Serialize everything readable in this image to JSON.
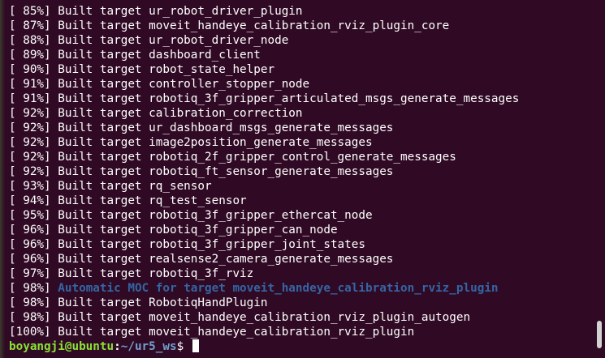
{
  "lines": [
    {
      "text": "[ 85%] Built target ur_robot_driver_plugin",
      "style": "normal"
    },
    {
      "text": "[ 87%] Built target moveit_handeye_calibration_rviz_plugin_core",
      "style": "normal"
    },
    {
      "text": "[ 88%] Built target ur_robot_driver_node",
      "style": "normal"
    },
    {
      "text": "[ 89%] Built target dashboard_client",
      "style": "normal"
    },
    {
      "text": "[ 90%] Built target robot_state_helper",
      "style": "normal"
    },
    {
      "text": "[ 91%] Built target controller_stopper_node",
      "style": "normal"
    },
    {
      "text": "[ 91%] Built target robotiq_3f_gripper_articulated_msgs_generate_messages",
      "style": "normal"
    },
    {
      "text": "[ 92%] Built target calibration_correction",
      "style": "normal"
    },
    {
      "text": "[ 92%] Built target ur_dashboard_msgs_generate_messages",
      "style": "normal"
    },
    {
      "text": "[ 92%] Built target image2position_generate_messages",
      "style": "normal"
    },
    {
      "text": "[ 92%] Built target robotiq_2f_gripper_control_generate_messages",
      "style": "normal"
    },
    {
      "text": "[ 92%] Built target robotiq_ft_sensor_generate_messages",
      "style": "normal"
    },
    {
      "text": "[ 93%] Built target rq_sensor",
      "style": "normal"
    },
    {
      "text": "[ 94%] Built target rq_test_sensor",
      "style": "normal"
    },
    {
      "text": "[ 95%] Built target robotiq_3f_gripper_ethercat_node",
      "style": "normal"
    },
    {
      "text": "[ 96%] Built target robotiq_3f_gripper_can_node",
      "style": "normal"
    },
    {
      "text": "[ 96%] Built target robotiq_3f_gripper_joint_states",
      "style": "normal"
    },
    {
      "text": "[ 96%] Built target realsense2_camera_generate_messages",
      "style": "normal"
    },
    {
      "text": "[ 97%] Built target robotiq_3f_rviz",
      "style": "normal"
    },
    {
      "text": "[ 98%] ",
      "style": "normal",
      "continuation": "Automatic MOC for target moveit_handeye_calibration_rviz_plugin"
    },
    {
      "text": "[ 98%] Built target RobotiqHandPlugin",
      "style": "normal"
    },
    {
      "text": "[ 98%] Built target moveit_handeye_calibration_rviz_plugin_autogen",
      "style": "normal"
    },
    {
      "text": "[100%] Built target moveit_handeye_calibration_rviz_plugin",
      "style": "normal"
    }
  ],
  "prompt": {
    "user_host": "boyangji@ubuntu",
    "separator": ":",
    "path": "~/ur5_ws",
    "symbol": "$ "
  },
  "colors": {
    "background": "#300a24",
    "text": "#ffffff",
    "moc_text": "#3465a4",
    "prompt_user": "#8ae234",
    "prompt_path": "#729fcf"
  }
}
